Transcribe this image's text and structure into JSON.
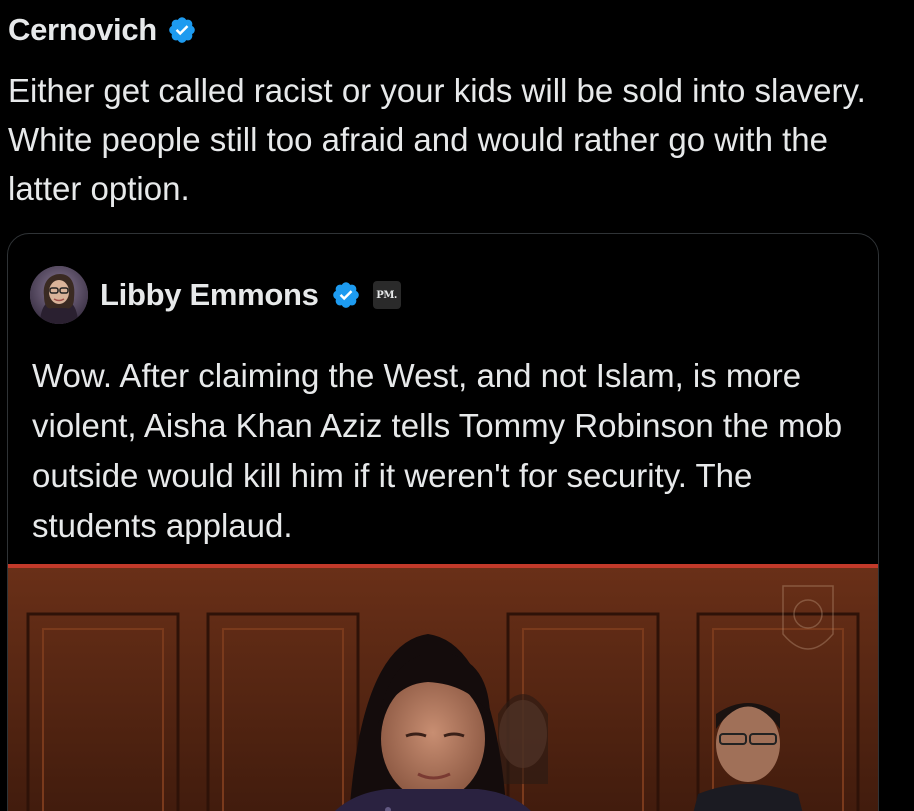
{
  "post": {
    "author": "Cernovich",
    "verified_icon": "verified-badge-icon",
    "text": "Either get called racist or your kids will be sold into slavery. White people still too afraid and would rather go with the latter option."
  },
  "quoted_post": {
    "author": "Libby Emmons",
    "verified_icon": "verified-badge-icon",
    "affiliate_badge": "PM.",
    "text": "Wow. After claiming the West, and not Islam, is more violent, Aisha Khan Aziz tells Tommy Robinson the mob outside would kill him if it weren't for security. The students applaud."
  },
  "colors": {
    "background": "#000000",
    "text": "#e7e9ea",
    "verified_blue": "#1d9bf0",
    "card_border": "#2f3336",
    "wood_panel": "#5a2a16"
  }
}
